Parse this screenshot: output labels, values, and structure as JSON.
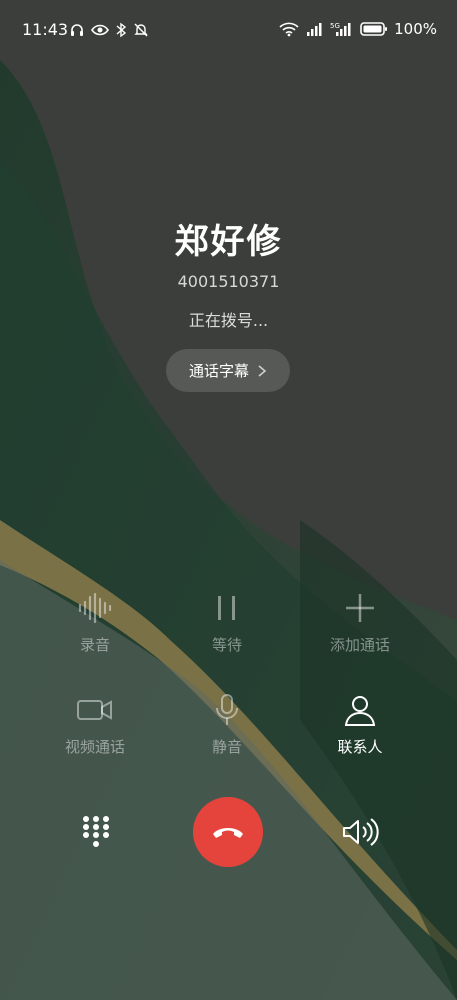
{
  "status_bar": {
    "time": "11:43",
    "left_icons": [
      "headset-icon",
      "eye-icon",
      "bluetooth-icon",
      "mute-bell-icon"
    ],
    "right_icons": [
      "wifi-icon",
      "signal-icon",
      "5g-signal-icon",
      "battery-icon"
    ],
    "battery_percent": "100%"
  },
  "contact": {
    "name": "郑好修",
    "number": "4001510371",
    "status": "正在拨号..."
  },
  "caption_button": {
    "label": "通话字幕"
  },
  "actions": {
    "record": "录音",
    "hold": "等待",
    "add_call": "添加通话",
    "video_call": "视频通话",
    "mute": "静音",
    "contacts": "联系人"
  },
  "colors": {
    "hangup": "#e5443c",
    "background": "#3a3d39",
    "accent_green": "#1f3b2c",
    "accent_gold": "#8a7a4a"
  }
}
